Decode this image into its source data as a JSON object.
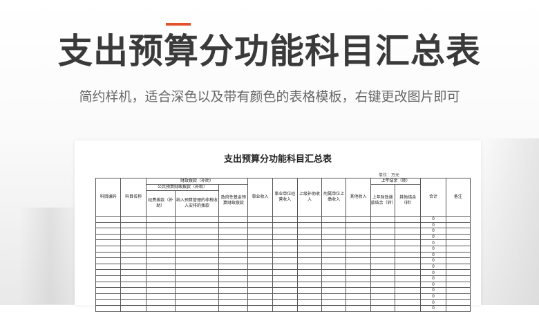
{
  "page": {
    "title": "支出预算分功能科目汇总表",
    "subtitle": "简约样机，适合深色以及带有颜色的表格模板，右键更改图片即可",
    "accent_color": "#e2512a"
  },
  "document": {
    "title": "支出预算分功能科目汇总表",
    "unit_label": "单位：万元",
    "headers": {
      "subject_code": "科目编码",
      "subject_name": "科目名称",
      "fiscal_allocation": "财政拨款（补助）",
      "public_budget_allocation": "公共预算财政拨款（补助）",
      "operating_funds_allocation": "经费拨款（补助）",
      "budget_managed_income": "纳入预算管理的非税收入安排的拨款",
      "gov_fund_allocation": "政府性基金预算财政拨款",
      "business_income": "事业收入",
      "business_unit_operating_income": "事业单位经营收入",
      "superior_subsidy_income": "上级补助收入",
      "affiliated_unit_income": "附属单位上缴收入",
      "other_income": "其他收入",
      "prior_year_balance": "上年结余（转）",
      "prior_year_fiscal_balance": "上年财政拨款结余（转）",
      "other_balance": "其他结余（转）",
      "total": "合计",
      "remarks": "备注"
    },
    "rows": [
      {
        "total": "0"
      },
      {
        "total": "0"
      },
      {
        "total": "0"
      },
      {
        "total": "0"
      },
      {
        "total": "0"
      },
      {
        "total": "0"
      },
      {
        "total": "0"
      },
      {
        "total": "0"
      },
      {
        "total": "0"
      },
      {
        "total": "0"
      },
      {
        "total": "0"
      },
      {
        "total": "0"
      },
      {
        "total": "0"
      },
      {
        "total": "0"
      },
      {
        "total": "0"
      },
      {
        "total": "0"
      }
    ]
  }
}
